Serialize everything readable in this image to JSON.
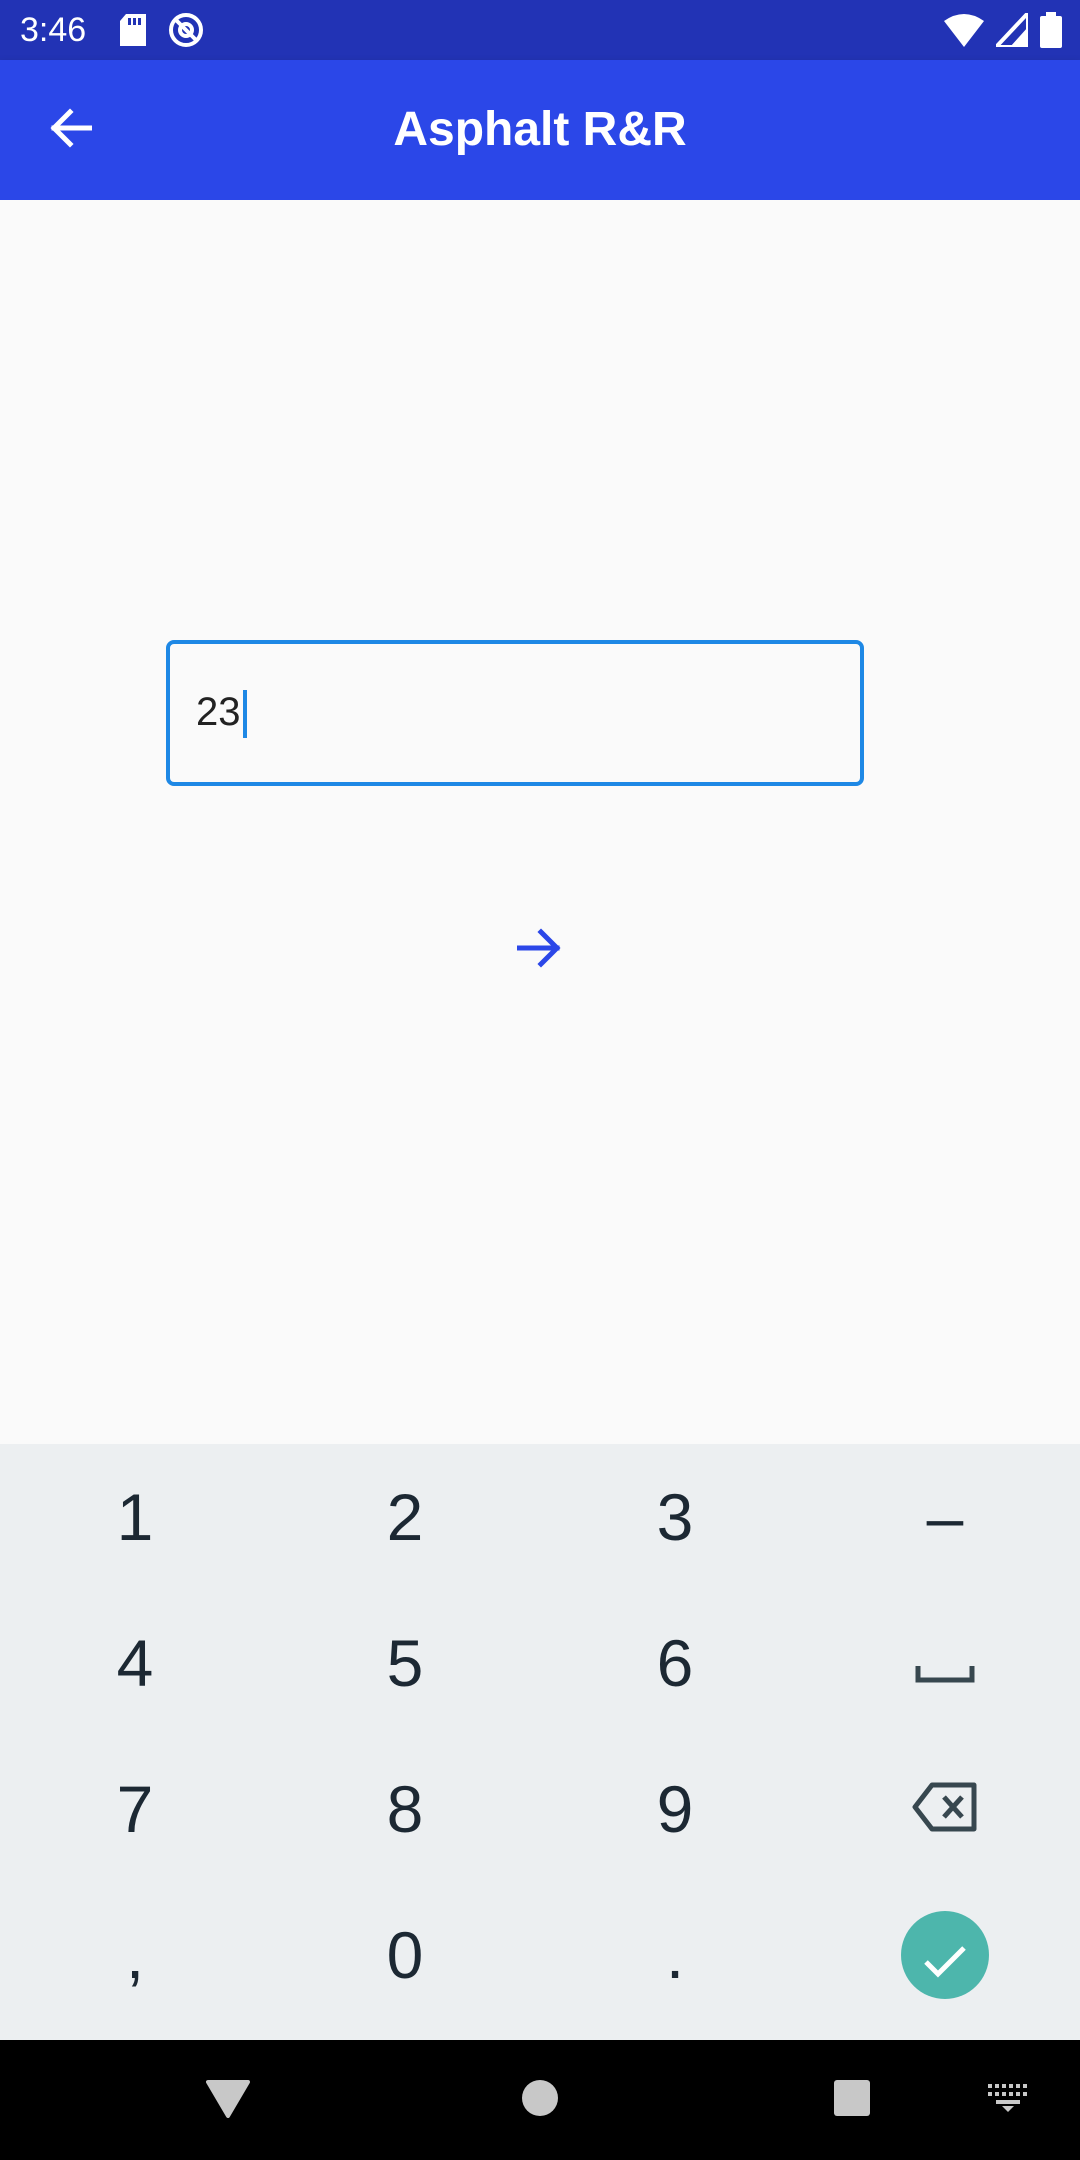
{
  "status_bar": {
    "time": "3:46",
    "icons": [
      "sd-card-icon",
      "at-sign-icon",
      "wifi-icon",
      "cell-signal-icon",
      "battery-icon"
    ]
  },
  "app_bar": {
    "title": "Asphalt R&R",
    "back_icon": "arrow-left-icon",
    "color": "#2b47e8"
  },
  "form": {
    "input_value": "23",
    "next_icon": "arrow-right-icon",
    "accent": "#1e88e5"
  },
  "keyboard": {
    "rows": [
      [
        "1",
        "2",
        "3",
        "–"
      ],
      [
        "4",
        "5",
        "6",
        "space-icon"
      ],
      [
        "7",
        "8",
        "9",
        "backspace-icon"
      ],
      [
        ",",
        "0",
        ".",
        "done-check-icon"
      ]
    ],
    "keys": {
      "k1": "1",
      "k2": "2",
      "k3": "3",
      "dash": "–",
      "k4": "4",
      "k5": "5",
      "k6": "6",
      "k7": "7",
      "k8": "8",
      "k9": "9",
      "comma": ",",
      "k0": "0",
      "period": "."
    },
    "done_color": "#4db6ac"
  },
  "nav_bar": {
    "icons": [
      "nav-back-icon",
      "nav-home-icon",
      "nav-recents-icon",
      "keyboard-switch-icon"
    ]
  }
}
